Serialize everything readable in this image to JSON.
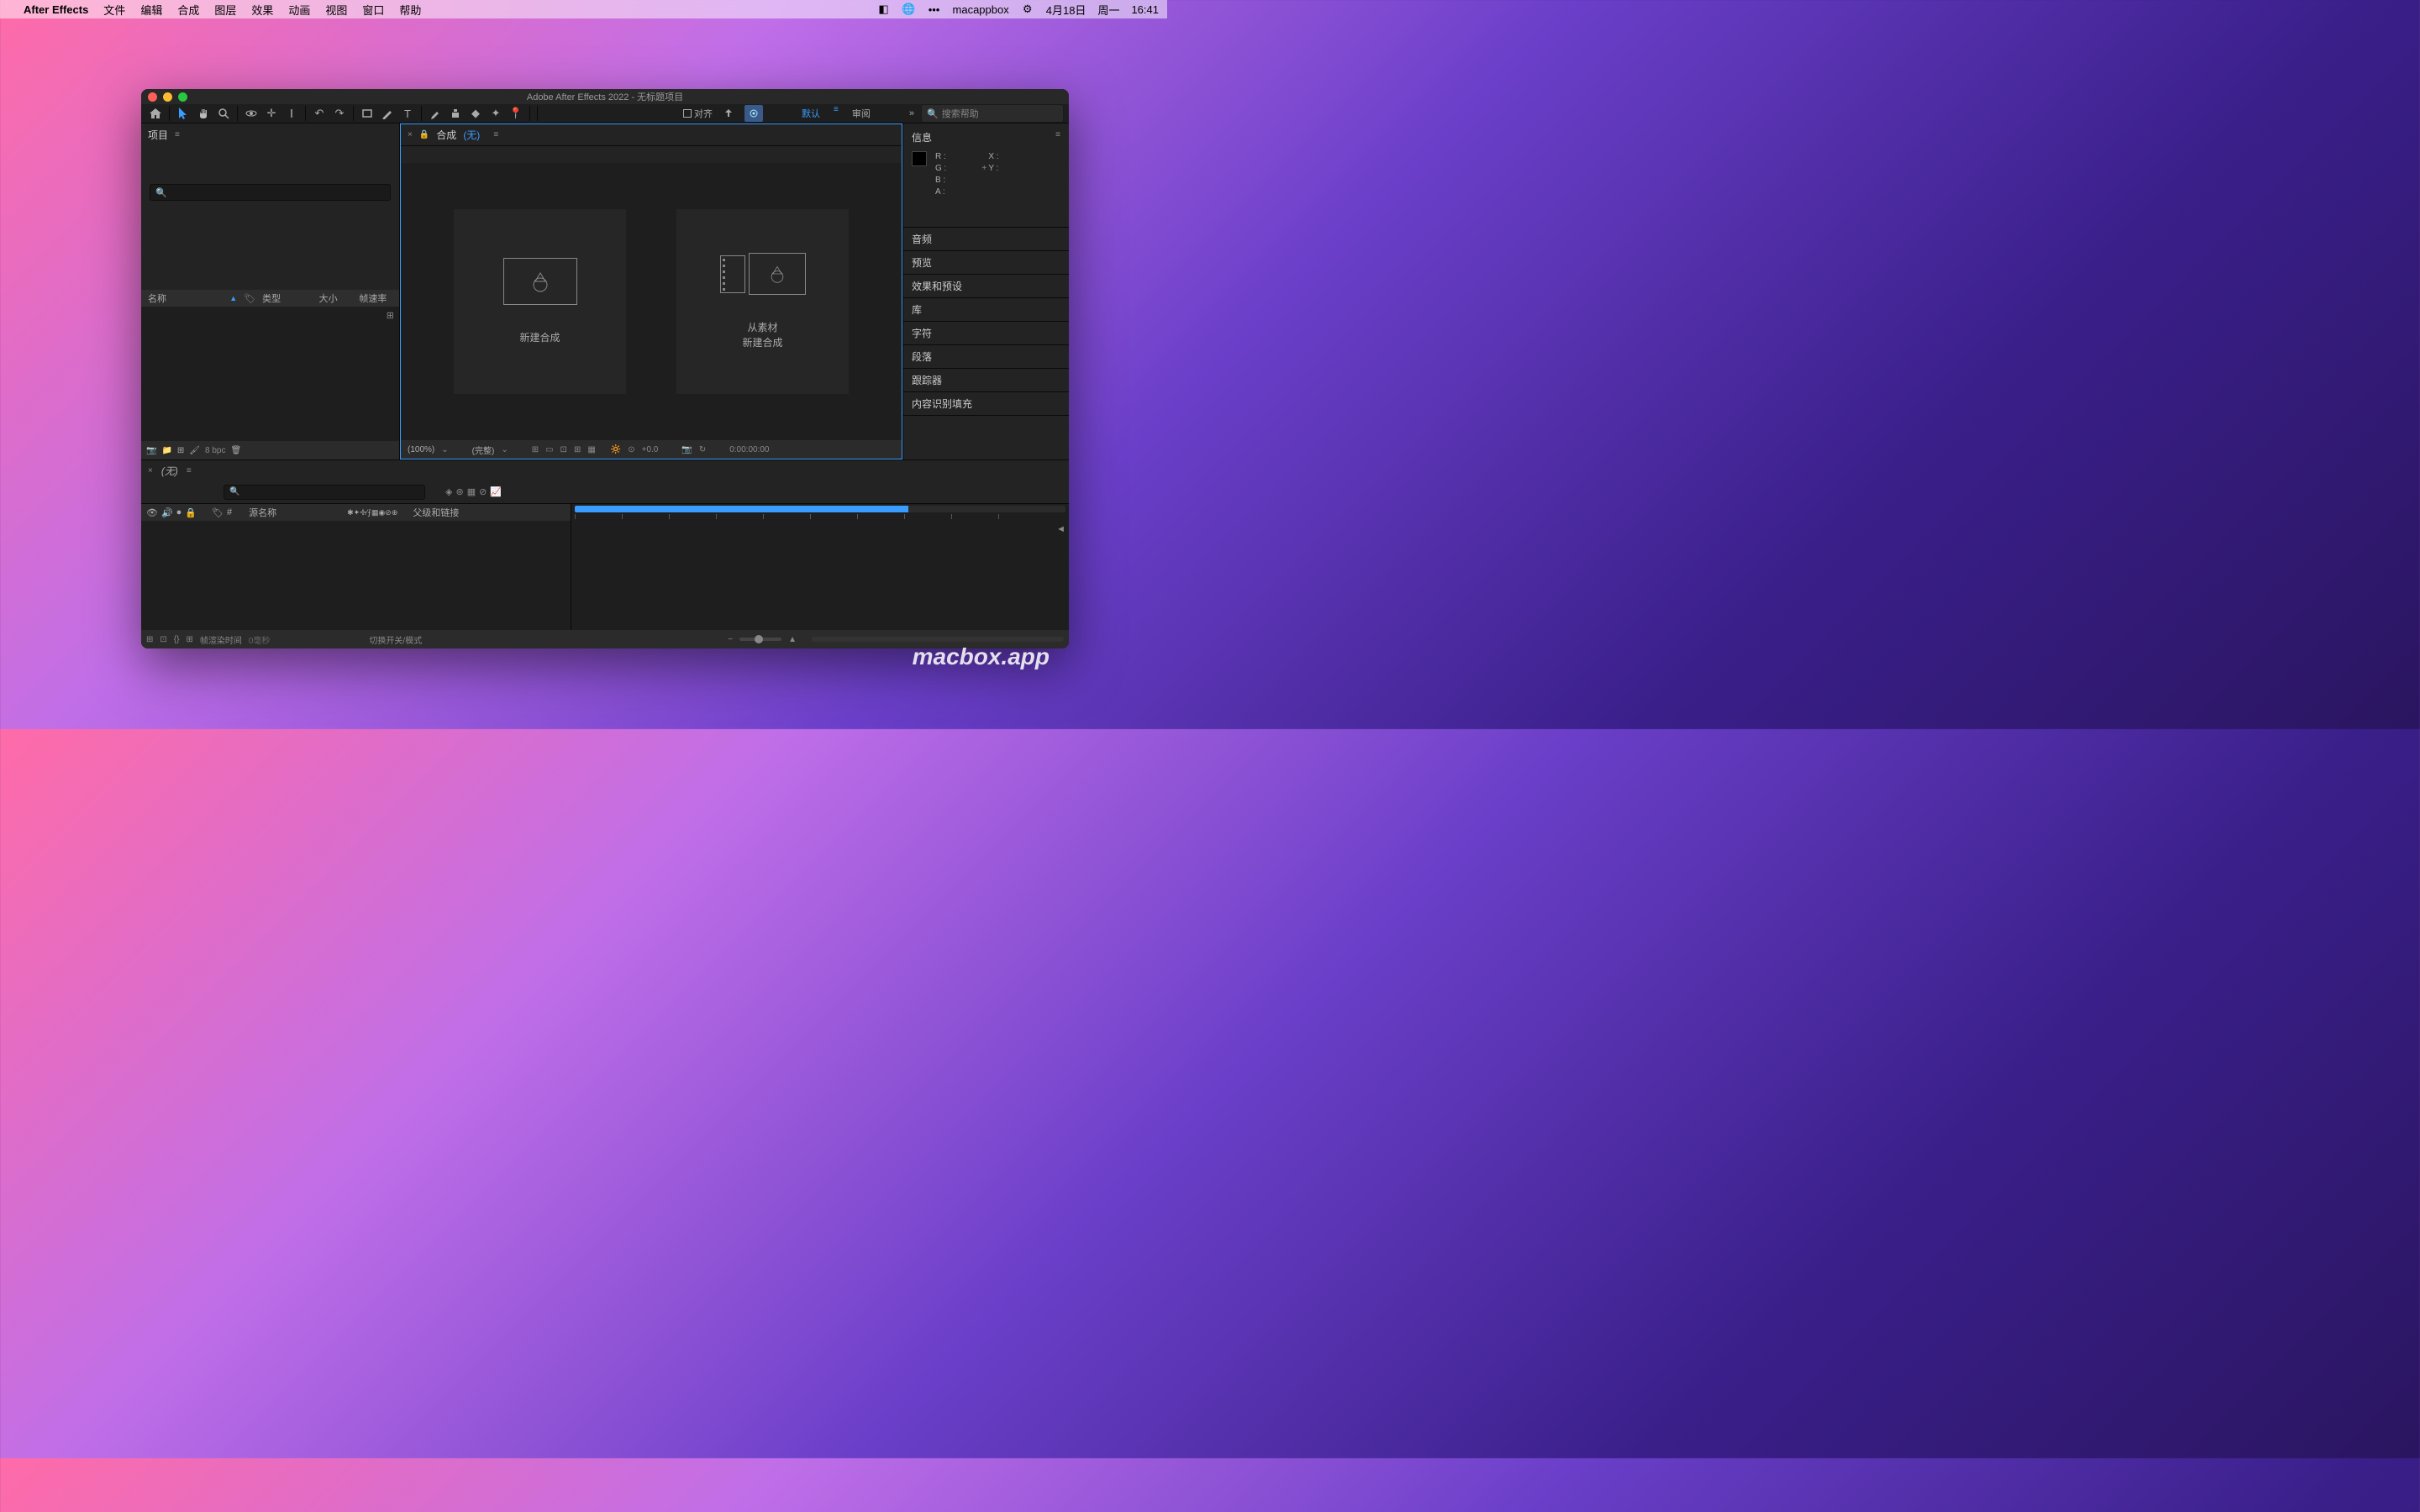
{
  "menubar": {
    "app_name": "After Effects",
    "items": [
      "文件",
      "编辑",
      "合成",
      "图层",
      "效果",
      "动画",
      "视图",
      "窗口",
      "帮助"
    ],
    "right": {
      "user": "macappbox",
      "date": "4月18日",
      "day": "周一",
      "time": "16:41"
    }
  },
  "window": {
    "title": "Adobe After Effects 2022 - 无标题项目"
  },
  "toolbar": {
    "align_label": "对齐",
    "workspaces": {
      "default": "默认",
      "review": "审阅"
    },
    "search_placeholder": "搜索帮助"
  },
  "panels": {
    "project": {
      "title": "项目",
      "columns": {
        "name": "名称",
        "type": "类型",
        "size": "大小",
        "fps": "帧速率"
      },
      "bpc": "8 bpc"
    },
    "composition": {
      "title": "合成",
      "none": "(无)",
      "new_comp": "新建合成",
      "from_footage_line1": "从素材",
      "from_footage_line2": "新建合成",
      "zoom": "(100%)",
      "resolution": "(完整)",
      "plus_zero": "+0.0",
      "timecode": "0:00:00:00"
    },
    "info": {
      "title": "信息",
      "r": "R :",
      "g": "G :",
      "b": "B :",
      "a": "A :",
      "x": "X :",
      "y": "Y :"
    },
    "side_items": [
      "音频",
      "预览",
      "效果和预设",
      "库",
      "字符",
      "段落",
      "跟踪器",
      "内容识别填充"
    ]
  },
  "timeline": {
    "none": "(无)",
    "source_name": "源名称",
    "parent_link": "父级和链接",
    "frame_render_time": "帧渲染时间",
    "zero_ms": "0毫秒",
    "toggle_switches": "切换开关/模式",
    "hash": "#"
  },
  "watermark": "macbox.app"
}
